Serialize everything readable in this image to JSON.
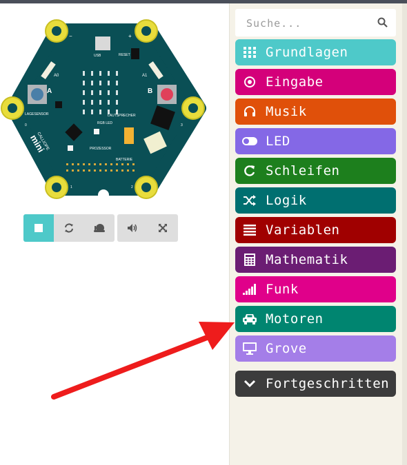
{
  "simulator": {
    "board_labels": {
      "usb": "USB",
      "reset": "RESET",
      "a0": "A0",
      "a1": "A1",
      "btn_a": "A",
      "btn_b": "B",
      "lagesensor": "LAGESENSOR",
      "lautsprecher": "LAUTSPRECHER",
      "rgb_led": "RGB LED",
      "prozessor": "PROZESSOR",
      "batterie": "BATTERIE",
      "brand_small": "CALLIOPE",
      "brand_big": "mini",
      "pin_minus": "−",
      "pin_plus": "+",
      "pin_0": "0",
      "pin_1": "1",
      "pin_2": "2",
      "pin_3": "3"
    },
    "controls": {
      "stop_icon": "stop-icon",
      "restart_icon": "restart-icon",
      "slowmo_icon": "snail-icon",
      "mute_icon": "volume-icon",
      "fullscreen_icon": "fullscreen-icon"
    }
  },
  "toolbox": {
    "search": {
      "placeholder": "Suche...",
      "icon": "search-icon"
    },
    "categories": [
      {
        "label": "Grundlagen",
        "color": "#4ec9c9",
        "icon": "grid-icon"
      },
      {
        "label": "Eingabe",
        "color": "#d4007a",
        "icon": "target-icon"
      },
      {
        "label": "Musik",
        "color": "#e0500a",
        "icon": "headphones-icon"
      },
      {
        "label": "LED",
        "color": "#8468e6",
        "icon": "toggle-icon"
      },
      {
        "label": "Schleifen",
        "color": "#1d7f1d",
        "icon": "loop-icon"
      },
      {
        "label": "Logik",
        "color": "#006f70",
        "icon": "shuffle-icon"
      },
      {
        "label": "Variablen",
        "color": "#a00000",
        "icon": "list-icon"
      },
      {
        "label": "Mathematik",
        "color": "#6b1d73",
        "icon": "calculator-icon"
      },
      {
        "label": "Funk",
        "color": "#e0008a",
        "icon": "signal-icon"
      },
      {
        "label": "Motoren",
        "color": "#008570",
        "icon": "car-icon"
      },
      {
        "label": "Grove",
        "color": "#a47ee8",
        "icon": "monitor-icon"
      }
    ],
    "advanced": {
      "label": "Fortgeschritten",
      "color": "#3c3c3c",
      "icon": "chevron-down-icon"
    }
  },
  "annotation": {
    "arrow_color": "#ee1c1c"
  }
}
